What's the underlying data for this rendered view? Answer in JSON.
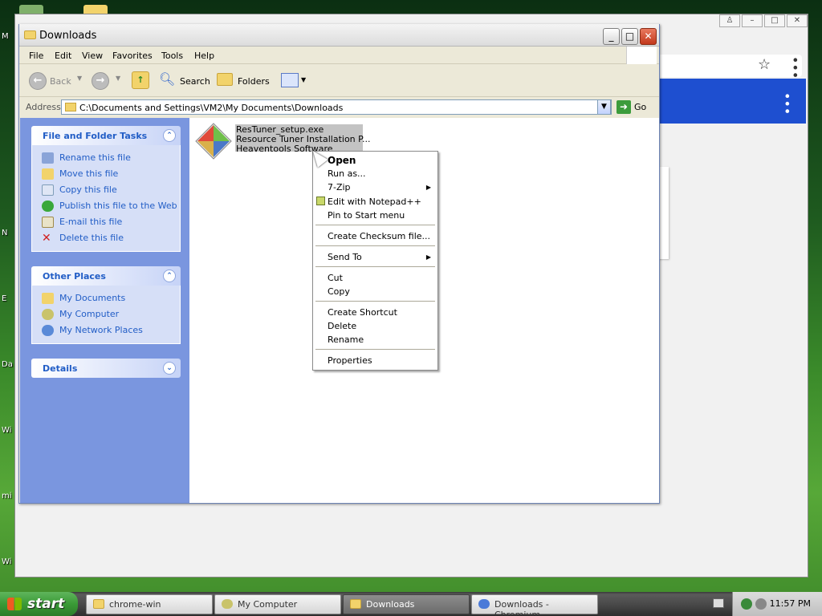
{
  "desktop": {
    "labels": [
      "M",
      "N",
      "E",
      "Da",
      "Wi",
      "mi",
      "Wi"
    ]
  },
  "explorer": {
    "title": "Downloads",
    "menu": [
      "File",
      "Edit",
      "View",
      "Favorites",
      "Tools",
      "Help"
    ],
    "toolbar": {
      "back": "Back",
      "search": "Search",
      "folders": "Folders"
    },
    "address": {
      "label": "Address",
      "path": "C:\\Documents and Settings\\VM2\\My Documents\\Downloads",
      "go": "Go"
    },
    "left_pane": {
      "file_tasks": {
        "title": "File and Folder Tasks",
        "items": [
          "Rename this file",
          "Move this file",
          "Copy this file",
          "Publish this file to the Web",
          "E-mail this file",
          "Delete this file"
        ]
      },
      "other_places": {
        "title": "Other Places",
        "items": [
          "My Documents",
          "My Computer",
          "My Network Places"
        ]
      },
      "details": {
        "title": "Details"
      }
    },
    "file": {
      "name": "ResTuner_setup.exe",
      "description": "Resource Tuner Installation P...",
      "company": "Heaventools Software"
    }
  },
  "context_menu": {
    "items": [
      "Open",
      "Run as...",
      "7-Zip",
      "Edit with Notepad++",
      "Pin to Start menu",
      "Create Checksum file...",
      "Send To",
      "Cut",
      "Copy",
      "Create Shortcut",
      "Delete",
      "Rename",
      "Properties"
    ]
  },
  "taskbar": {
    "start": "start",
    "tasks": [
      "chrome-win",
      "My Computer",
      "Downloads",
      "Downloads - Chromium"
    ],
    "clock": "11:57 PM"
  },
  "colors": {
    "task_link": "#215dc6",
    "left_pane_bg": "#7a96df",
    "selection": "#c3c3c3",
    "chrome_blue": "#1e4fd0"
  }
}
